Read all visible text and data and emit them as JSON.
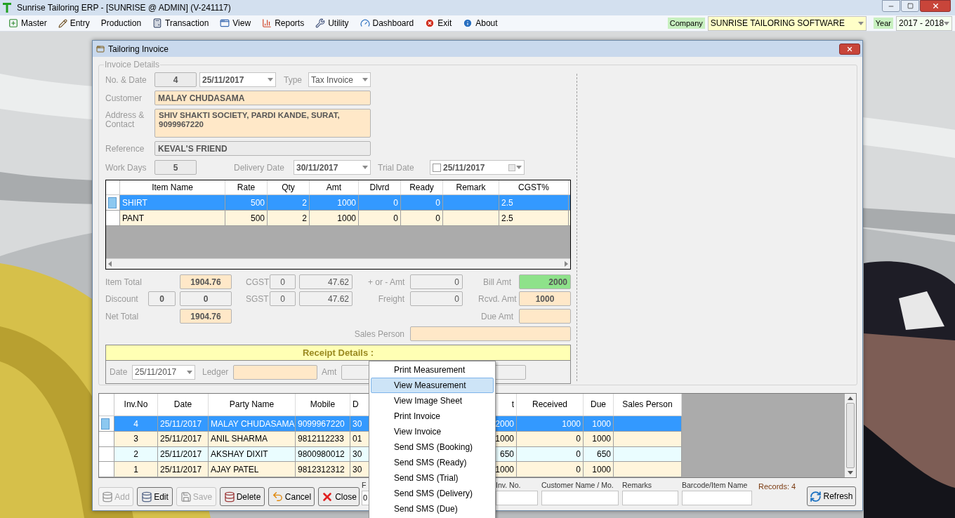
{
  "app": {
    "title": "Sunrise Tailoring ERP - [SUNRISE @ ADMIN] (V-241117)"
  },
  "menu": [
    {
      "label": "Master"
    },
    {
      "label": "Entry"
    },
    {
      "label": "Production"
    },
    {
      "label": "Transaction"
    },
    {
      "label": "View"
    },
    {
      "label": "Reports"
    },
    {
      "label": "Utility"
    },
    {
      "label": "Dashboard"
    },
    {
      "label": "Exit"
    },
    {
      "label": "About"
    }
  ],
  "company": {
    "label": "Company",
    "value": "SUNRISE TAILORING SOFTWARE"
  },
  "year": {
    "label": "Year",
    "value": "2017 - 2018"
  },
  "dialog": {
    "title": "Tailoring Invoice"
  },
  "invoice": {
    "legend": "Invoice Details",
    "no_date": {
      "label": "No. & Date",
      "number": "4",
      "date": "25/11/2017"
    },
    "type": {
      "label": "Type",
      "value": "Tax Invoice"
    },
    "customer": {
      "label": "Customer",
      "value": "MALAY CHUDASAMA"
    },
    "address": {
      "label": "Address & Contact",
      "value": "SHIV SHAKTI SOCIETY, PARDI KANDE, SURAT, 9099967220"
    },
    "reference": {
      "label": "Reference",
      "value": "KEVAL'S FRIEND"
    },
    "work_days": {
      "label": "Work Days",
      "value": "5"
    },
    "delivery_date": {
      "label": "Delivery Date",
      "value": "30/11/2017"
    },
    "trial_date": {
      "label": "Trial Date",
      "value": "25/11/2017",
      "checked": false
    }
  },
  "items": {
    "columns": [
      "Item Name",
      "Rate",
      "Qty",
      "Amt",
      "Dlvrd",
      "Ready",
      "Remark",
      "CGST%"
    ],
    "rows": [
      {
        "selected": true,
        "item_name": "SHIRT",
        "rate": "500",
        "qty": "2",
        "amt": "1000",
        "dlvrd": "0",
        "ready": "0",
        "cgst": "2.5"
      },
      {
        "selected": false,
        "item_name": "PANT",
        "rate": "500",
        "qty": "2",
        "amt": "1000",
        "dlvrd": "0",
        "ready": "0",
        "cgst": "2.5"
      }
    ]
  },
  "totals": {
    "item_total": {
      "label": "Item Total",
      "value": "1904.76"
    },
    "discount": {
      "label": "Discount",
      "percent": "0",
      "value": "0"
    },
    "net_total": {
      "label": "Net Total",
      "value": "1904.76"
    },
    "cgst": {
      "label": "CGST",
      "rate": "0",
      "value": "47.62"
    },
    "sgst": {
      "label": "SGST",
      "rate": "0",
      "value": "47.62"
    },
    "plus_minus": {
      "label": "+ or - Amt",
      "value": "0"
    },
    "freight": {
      "label": "Freight",
      "value": "0"
    },
    "bill_amt": {
      "label": "Bill Amt",
      "value": "2000"
    },
    "rcvd_amt": {
      "label": "Rcvd. Amt",
      "value": "1000"
    },
    "due_amt": {
      "label": "Due Amt"
    },
    "sales_person": {
      "label": "Sales Person"
    }
  },
  "receipt": {
    "title": "Receipt Details :",
    "date_label": "Date",
    "date": "25/11/2017",
    "ledger_label": "Ledger",
    "amt_label": "Amt"
  },
  "invoices": {
    "columns": [
      "Inv.No",
      "Date",
      "Party Name",
      "Mobile",
      "D",
      "t",
      "Received",
      "Due",
      "Sales Person"
    ],
    "rows": [
      {
        "selected": true,
        "inv_no": "4",
        "date": "25/11/2017",
        "party": "MALAY CHUDASAMA",
        "mobile": "9099967220",
        "column_5": "30",
        "column_6": "2000",
        "received": "1000",
        "due": "1000"
      },
      {
        "selected": false,
        "inv_no": "3",
        "date": "25/11/2017",
        "party": "ANIL SHARMA",
        "mobile": "9812112233",
        "column_5": "01",
        "column_6": "1000",
        "received": "0",
        "due": "1000"
      },
      {
        "selected": false,
        "inv_no": "2",
        "date": "25/11/2017",
        "party": "AKSHAY DIXIT",
        "mobile": "9800980012",
        "column_5": "30",
        "column_6": "650",
        "received": "0",
        "due": "650"
      },
      {
        "selected": false,
        "inv_no": "1",
        "date": "25/11/2017",
        "party": "AJAY PATEL",
        "mobile": "9812312312",
        "column_5": "30",
        "column_6": "1000",
        "received": "0",
        "due": "1000"
      }
    ]
  },
  "buttons": [
    {
      "label": "Add",
      "disabled": true
    },
    {
      "label": "Edit",
      "disabled": false
    },
    {
      "label": "Save",
      "disabled": true
    },
    {
      "label": "Delete",
      "disabled": false
    },
    {
      "label": "Cancel",
      "disabled": false
    },
    {
      "label": "Close",
      "disabled": false
    }
  ],
  "filters": [
    {
      "label": "F",
      "value": "0"
    },
    {
      "label": "Inv. No."
    },
    {
      "label": "Customer Name / Mo."
    },
    {
      "label": "Remarks"
    },
    {
      "label": "Barcode/Item Name"
    }
  ],
  "records": "Records: 4",
  "refresh": {
    "label": "Refresh"
  },
  "context_menu": [
    {
      "label": "Print Measurement",
      "selected": false
    },
    {
      "label": "View Measurement",
      "selected": true
    },
    {
      "label": "View Image Sheet",
      "selected": false
    },
    {
      "label": "Print Invoice",
      "selected": false
    },
    {
      "label": "View Invoice",
      "selected": false
    },
    {
      "label": "Send SMS (Booking)",
      "selected": false
    },
    {
      "label": "Send SMS (Ready)",
      "selected": false
    },
    {
      "label": "Send SMS (Trial)",
      "selected": false
    },
    {
      "label": "Send SMS (Delivery)",
      "selected": false
    },
    {
      "label": "Send SMS (Due)",
      "selected": false
    }
  ]
}
